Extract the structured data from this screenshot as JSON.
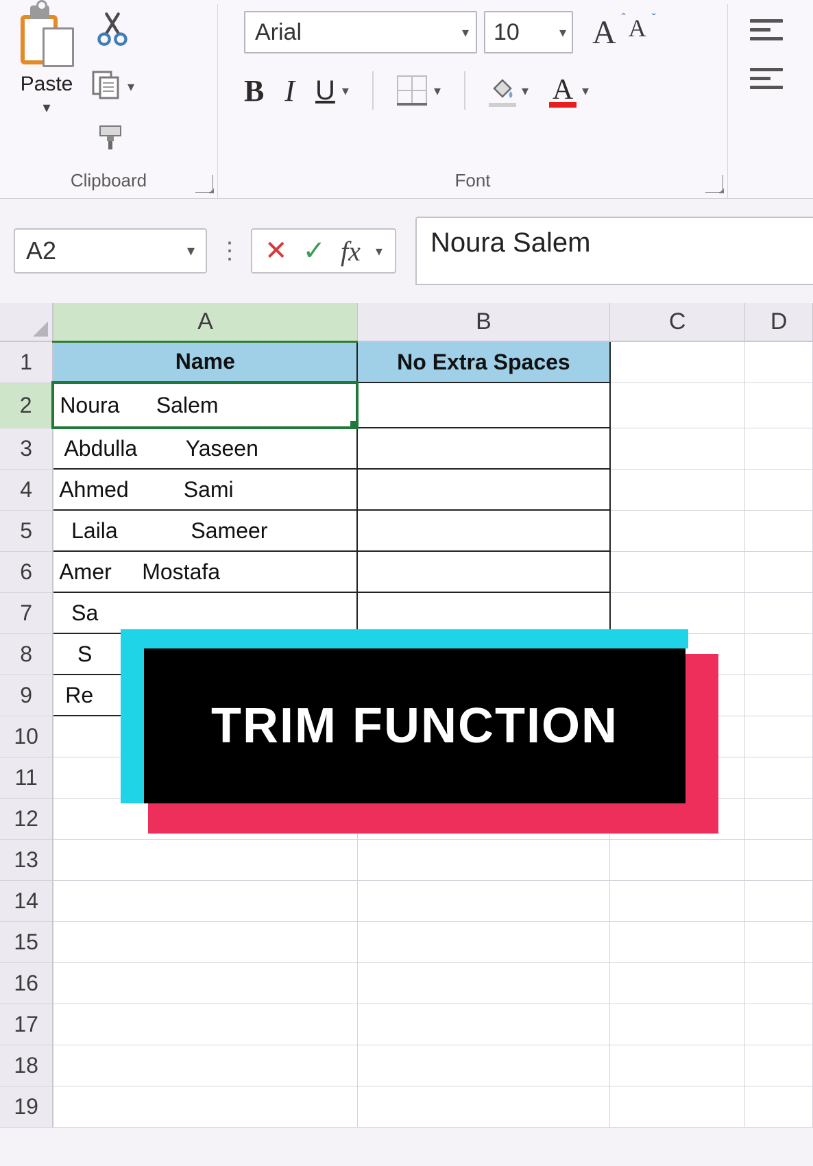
{
  "ribbon": {
    "clipboard": {
      "paste_label": "Paste",
      "group_label": "Clipboard"
    },
    "font": {
      "group_label": "Font",
      "font_name": "Arial",
      "font_size": "10",
      "bold": "B",
      "italic": "I",
      "underline": "U",
      "grow": "A",
      "shrink": "A",
      "font_color_accent": "#e81e1e"
    }
  },
  "formula_bar": {
    "name_box": "A2",
    "cancel": "✕",
    "enter": "✓",
    "fx": "fx",
    "formula_value": "Noura    Salem"
  },
  "columns": [
    "A",
    "B",
    "C",
    "D"
  ],
  "row_headers": [
    "1",
    "2",
    "3",
    "4",
    "5",
    "6",
    "7",
    "8",
    "9",
    "10",
    "11",
    "12",
    "13",
    "14",
    "15",
    "16",
    "17",
    "18",
    "19"
  ],
  "headers": {
    "A1": "Name",
    "B1": "No Extra Spaces"
  },
  "cells": {
    "A2": "Noura      Salem",
    "A3": " Abdulla        Yaseen",
    "A4": "Ahmed         Sami",
    "A5": "  Laila            Sameer",
    "A6": "Amer     Mostafa",
    "A7": "  Sa",
    "A8": "   S",
    "A9": " Re"
  },
  "selected_cell": "A2",
  "overlay": {
    "text": "TRIM FUNCTION",
    "cyan": "#20d4e7",
    "pink": "#ef2f5b"
  }
}
